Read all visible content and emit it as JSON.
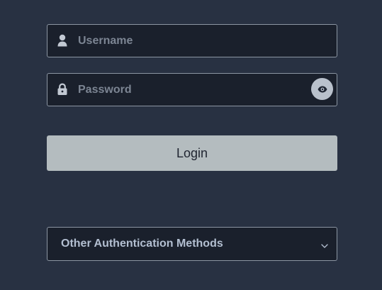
{
  "login_form": {
    "username": {
      "value": "",
      "placeholder": "Username",
      "icon": "user-icon"
    },
    "password": {
      "value": "",
      "placeholder": "Password",
      "icon": "lock-icon",
      "toggle_icon": "eye-icon"
    },
    "login_label": "Login",
    "other_methods_label": "Other Authentication Methods",
    "other_methods_icon": "chevron-down-icon"
  },
  "colors": {
    "background": "#283142",
    "field_background": "#1a202c",
    "field_border": "#8c96a3",
    "placeholder": "#7c8593",
    "login_button": "#b4bcbf",
    "login_text": "#1f2430",
    "other_methods_text": "#b3bfd1"
  }
}
